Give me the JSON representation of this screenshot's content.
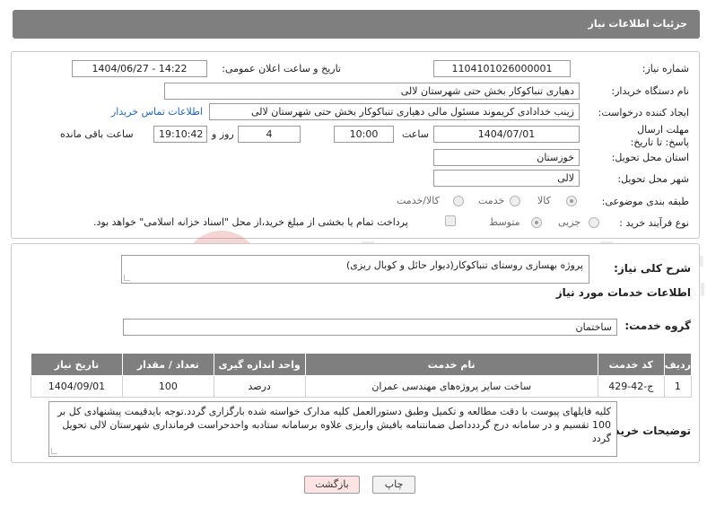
{
  "header": {
    "title": "جزئیات اطلاعات نیاز"
  },
  "form": {
    "need_number_label": "شماره نیاز:",
    "need_number": "1104101026000001",
    "announce_label": "تاریخ و ساعت اعلان عمومی:",
    "announce_value": "1404/06/27 - 14:22",
    "buyer_org_label": "نام دستگاه خریدار:",
    "buyer_org": "دهیاری تنباکوکار بخش حتی شهرستان لالی",
    "requester_label": "ایجاد کننده درخواست:",
    "requester": "زینب خدادادی کریموند مسئول مالی دهیاری تنباکوکار بخش حتی شهرستان لالی",
    "contact_link": "اطلاعات تماس خریدار",
    "deadline_label": "مهلت ارسال پاسخ: تا تاریخ:",
    "deadline_date": "1404/07/01",
    "time_label": "ساعت",
    "deadline_time": "10:00",
    "days_value": "4",
    "days_label": "روز و",
    "remaining_time": "19:10:42",
    "remaining_label": "ساعت باقی مانده",
    "province_label": "استان محل تحویل:",
    "province": "خوزستان",
    "city_label": "شهر محل تحویل:",
    "city": "لالی",
    "category_label": "طبقه بندی موضوعی:",
    "category_options": [
      "کالا",
      "خدمت",
      "کالا/خدمت"
    ],
    "process_label": "نوع فرآیند خرید :",
    "process_options": [
      "جزیی",
      "متوسط"
    ],
    "payment_note": "پرداخت تمام یا بخشی از مبلغ خرید،از محل \"اسناد خزانه اسلامی\" خواهد بود."
  },
  "details": {
    "description_label": "شرح کلی نیاز:",
    "description": "پروژه بهسازی روستای تنباکوکار(دیوار حائل و کوبال ریزی)",
    "services_title": "اطلاعات خدمات مورد نیاز",
    "service_group_label": "گروه خدمت:",
    "service_group": "ساختمان",
    "table": {
      "headers": [
        "ردیف",
        "کد خدمت",
        "نام خدمت",
        "واحد اندازه گیری",
        "تعداد / مقدار",
        "تاریخ نیاز"
      ],
      "rows": [
        [
          "1",
          "ج-42-429",
          "ساخت سایر پروژه‌های مهندسی عمران",
          "درصد",
          "100",
          "1404/09/01"
        ]
      ]
    },
    "buyer_notes_label": "توضیحات خریدار:",
    "buyer_notes": "کلیه فایلهای پیوست  با دقت مطالعه و تکمیل وطبق دستورالعمل کلیه مدارک خواسته شده بارگزاری گردد.توجه بایدقیمت پیشنهادی کل بر 100 تقسیم و در سامانه درج گرددداصل ضمانتنامه بافیش  واریزی علاوه برسامانه ستادبه واحدحراست فرمانداری شهرستان لالی  تحویل گردد"
  },
  "buttons": {
    "print": "چاپ",
    "back": "بازگشت"
  },
  "watermark": {
    "text": "AriaTender.net"
  },
  "colors": {
    "header_bg": "#7f7f7f",
    "link": "#2166b8",
    "back_button_bg": "#fde3e3"
  }
}
